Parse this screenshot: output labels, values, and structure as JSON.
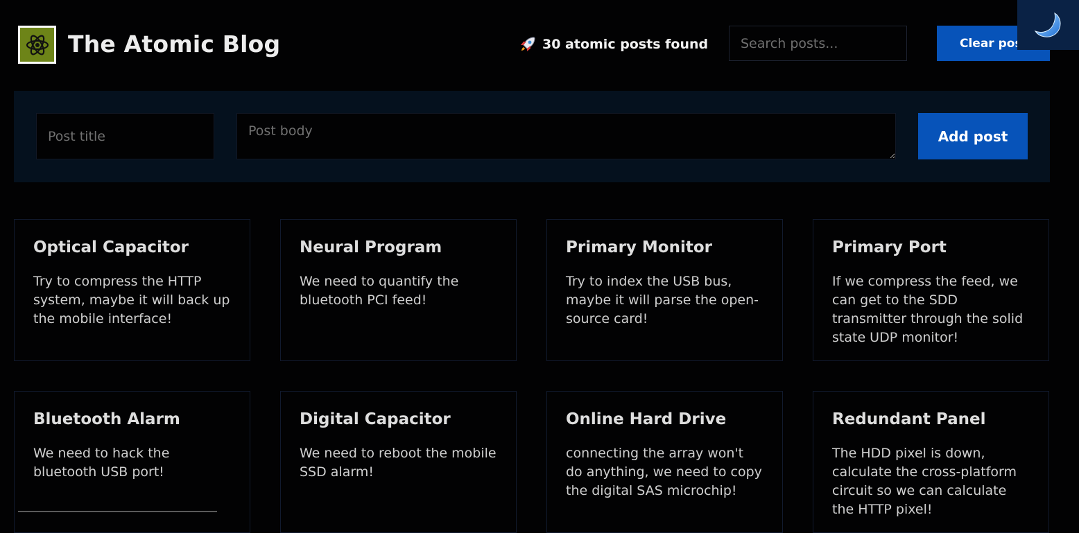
{
  "header": {
    "logo_icon": "atom-icon",
    "title": "The Atomic Blog",
    "post_count_icon": "rocket-icon",
    "post_count_text": "30 atomic posts found",
    "search_placeholder": "Search posts...",
    "clear_label": "Clear posts",
    "theme_toggle_icon": "moon-icon"
  },
  "form": {
    "title_placeholder": "Post title",
    "body_placeholder": "Post body",
    "add_label": "Add post"
  },
  "posts": [
    {
      "title": "Optical Capacitor",
      "body": "Try to compress the HTTP system, maybe it will back up the mobile interface!"
    },
    {
      "title": "Neural Program",
      "body": "We need to quantify the bluetooth PCI feed!"
    },
    {
      "title": "Primary Monitor",
      "body": "Try to index the USB bus, maybe it will parse the open-source card!"
    },
    {
      "title": "Primary Port",
      "body": "If we compress the feed, we can get to the SDD transmitter through the solid state UDP monitor!"
    },
    {
      "title": "Bluetooth Alarm",
      "body": "We need to hack the bluetooth USB port!"
    },
    {
      "title": "Digital Capacitor",
      "body": "We need to reboot the mobile SSD alarm!"
    },
    {
      "title": "Online Hard Drive",
      "body": "connecting the array won't do anything, we need to copy the digital SAS microchip!"
    },
    {
      "title": "Redundant Panel",
      "body": "The HDD pixel is down, calculate the cross-platform circuit so we can calculate the HTTP pixel!"
    }
  ],
  "colors": {
    "background": "#020203",
    "accent": "#0753b9",
    "logo_bg": "#6d8418",
    "panel_bg": "#05111e",
    "toggle_bg": "#0a2245"
  }
}
